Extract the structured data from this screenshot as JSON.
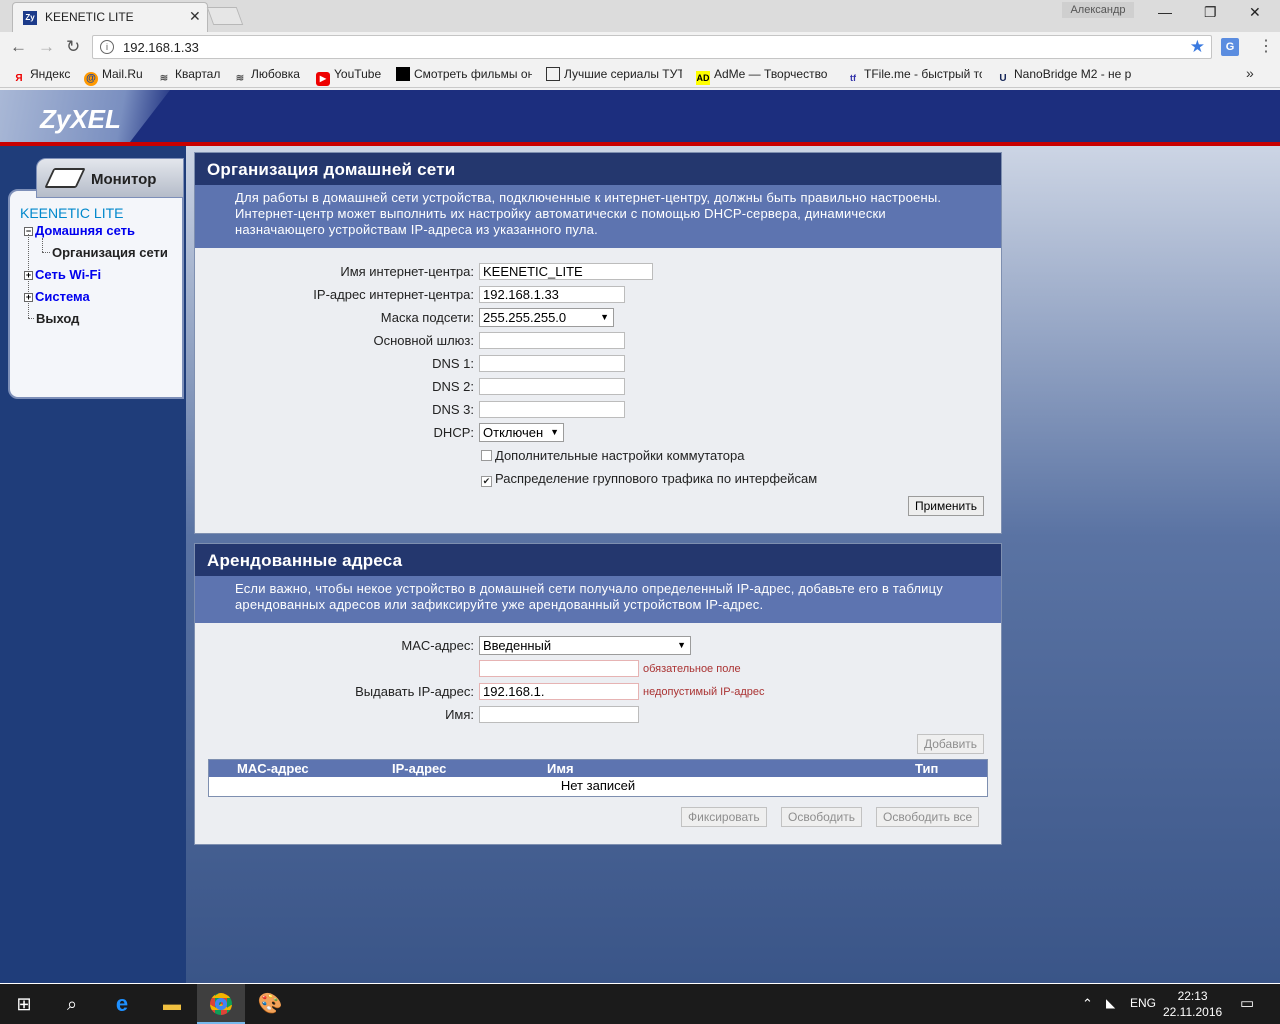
{
  "browser": {
    "tab_title": "KEENETIC LITE",
    "tab_favicon": "Zy",
    "user_name": "Александр",
    "url": "192.168.1.33",
    "bookmarks": [
      {
        "label": "Яндекс",
        "icon": "Я",
        "color": "#e00"
      },
      {
        "label": "Mail.Ru",
        "icon": "@",
        "color": "#f90"
      },
      {
        "label": "Квартал",
        "icon": "rss",
        "color": "#555"
      },
      {
        "label": "Любовка",
        "icon": "rss",
        "color": "#555"
      },
      {
        "label": "YouTube",
        "icon": "▶",
        "color": "#e00"
      },
      {
        "label": "Смотреть фильмы он",
        "icon": "■",
        "color": "#000"
      },
      {
        "label": "Лучшие сериалы ТУТ",
        "icon": "tv",
        "color": "#333"
      },
      {
        "label": "AdMe — Творчество",
        "icon": "AD",
        "color": "#ff0"
      },
      {
        "label": "TFile.me - быстрый тс",
        "icon": "tf",
        "color": "#33a"
      },
      {
        "label": "NanoBridge M2 - не р",
        "icon": "U",
        "color": "#125"
      }
    ],
    "more_label": "»"
  },
  "router": {
    "brand": "ZyXEL",
    "monitor_label": "Монитор",
    "nav": {
      "device": "KEENETIC LITE",
      "home_network": "Домашняя сеть",
      "network_org": "Организация сети",
      "wifi": "Сеть Wi-Fi",
      "system": "Система",
      "logout": "Выход"
    }
  },
  "home_panel": {
    "title": "Организация домашней сети",
    "description": "Для работы в домашней сети устройства, подключенные к интернет-центру, должны быть правильно настроены. Интернет-центр может выполнить их настройку автоматически с помощью DHCP-сервера, динамически назначающего устройствам IP-адреса из указанного пула.",
    "fields": {
      "name_label": "Имя интернет-центра:",
      "name_value": "KEENETIC_LITE",
      "ip_label": "IP-адрес интернет-центра:",
      "ip_value": "192.168.1.33",
      "mask_label": "Маска подсети:",
      "mask_value": "255.255.255.0",
      "gateway_label": "Основной шлюз:",
      "gateway_value": "",
      "dns1_label": "DNS 1:",
      "dns1_value": "",
      "dns2_label": "DNS 2:",
      "dns2_value": "",
      "dns3_label": "DNS 3:",
      "dns3_value": "",
      "dhcp_label": "DHCP:",
      "dhcp_value": "Отключен"
    },
    "checkbox_switch": {
      "label": "Дополнительные настройки коммутатора",
      "checked": false
    },
    "checkbox_multicast": {
      "label": "Распределение группового трафика по интерфейсам",
      "checked": true
    },
    "apply_label": "Применить"
  },
  "lease_panel": {
    "title": "Арендованные адреса",
    "description": "Если важно, чтобы некое устройство в домашней сети получало определенный IP-адрес, добавьте его в таблицу арендованных адресов или зафиксируйте уже арендованный устройством IP-адрес.",
    "mac_label": "MAC-адрес:",
    "mac_mode": "Введенный",
    "mac_value": "",
    "mac_note": "обязательное поле",
    "ip_label": "Выдавать IP-адрес:",
    "ip_value": "192.168.1.",
    "ip_note": "недопустимый IP-адрес",
    "name_label": "Имя:",
    "name_value": "",
    "add_label": "Добавить",
    "table": {
      "headers": [
        "MAC-адрес",
        "IP-адрес",
        "Имя",
        "Тип"
      ],
      "empty": "Нет записей"
    },
    "fix_label": "Фиксировать",
    "release_label": "Освободить",
    "release_all_label": "Освободить все"
  },
  "taskbar": {
    "lang": "ENG",
    "time": "22:13",
    "date": "22.11.2016"
  }
}
